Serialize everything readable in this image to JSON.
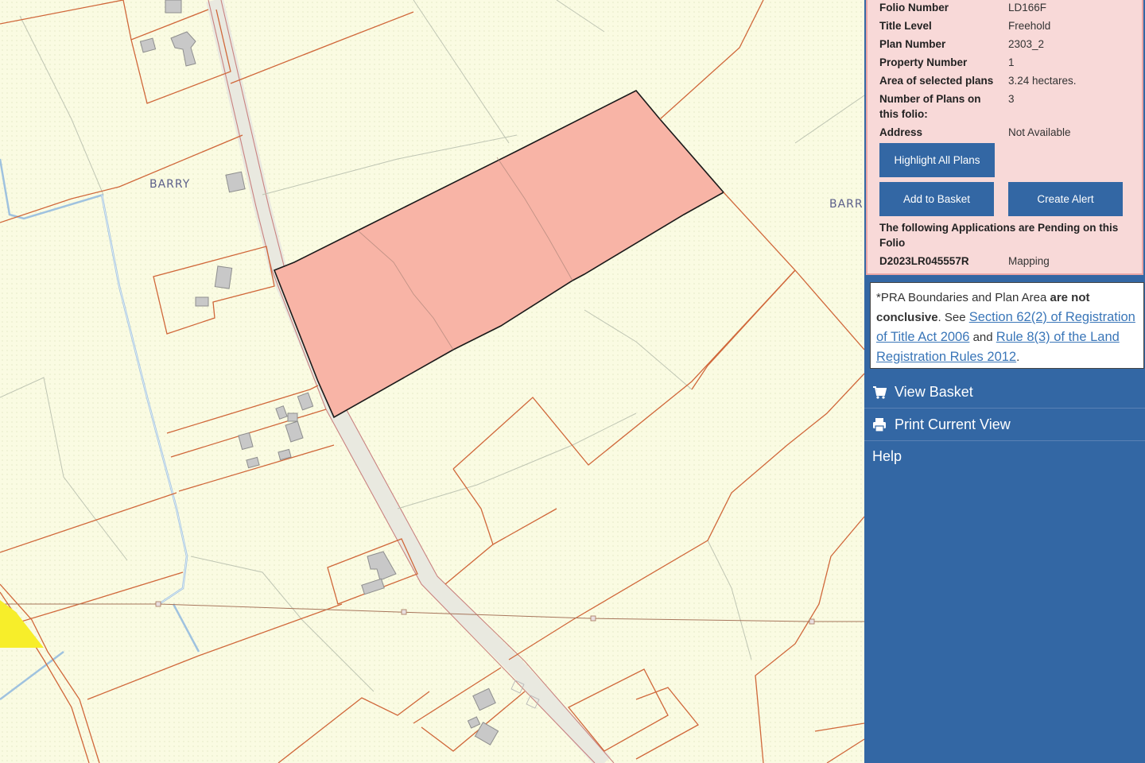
{
  "map": {
    "labels": [
      "BARRY",
      "BARR"
    ]
  },
  "folio": {
    "rows": [
      {
        "key": "Folio Number",
        "value": "LD166F"
      },
      {
        "key": "Title Level",
        "value": "Freehold"
      },
      {
        "key": "Plan Number",
        "value": "2303_2"
      },
      {
        "key": "Property Number",
        "value": "1"
      },
      {
        "key": "Area of selected plans",
        "value": "3.24 hectares."
      },
      {
        "key": "Number of Plans on this folio:",
        "value": "3"
      },
      {
        "key": "Address",
        "value": "Not Available"
      }
    ],
    "buttons": {
      "highlight": "Highlight All Plans",
      "basket": "Add to Basket",
      "alert": "Create Alert"
    },
    "pending_heading": "The following Applications are Pending on this Folio",
    "pending": {
      "id": "D2023LR045557R",
      "type": "Mapping"
    }
  },
  "disclaimer": {
    "prefix": "*PRA Boundaries and Plan Area ",
    "bold": "are not conclusive",
    "see": ". See ",
    "link1": "Section 62(2) of Registration of Title Act 2006",
    "and": " and ",
    "link2": "Rule 8(3) of the Land Registration Rules 2012",
    "end": "."
  },
  "menu": {
    "view_basket": "View Basket",
    "print_view": "Print Current View",
    "help": "Help"
  },
  "colors": {
    "panel": "#3367a4",
    "info_bg": "#f8d9d8",
    "selected_plot": "#f8b4a6",
    "boundary": "#d0673a"
  },
  "icons": {
    "view_basket": "cart-icon",
    "print_view": "printer-icon"
  }
}
